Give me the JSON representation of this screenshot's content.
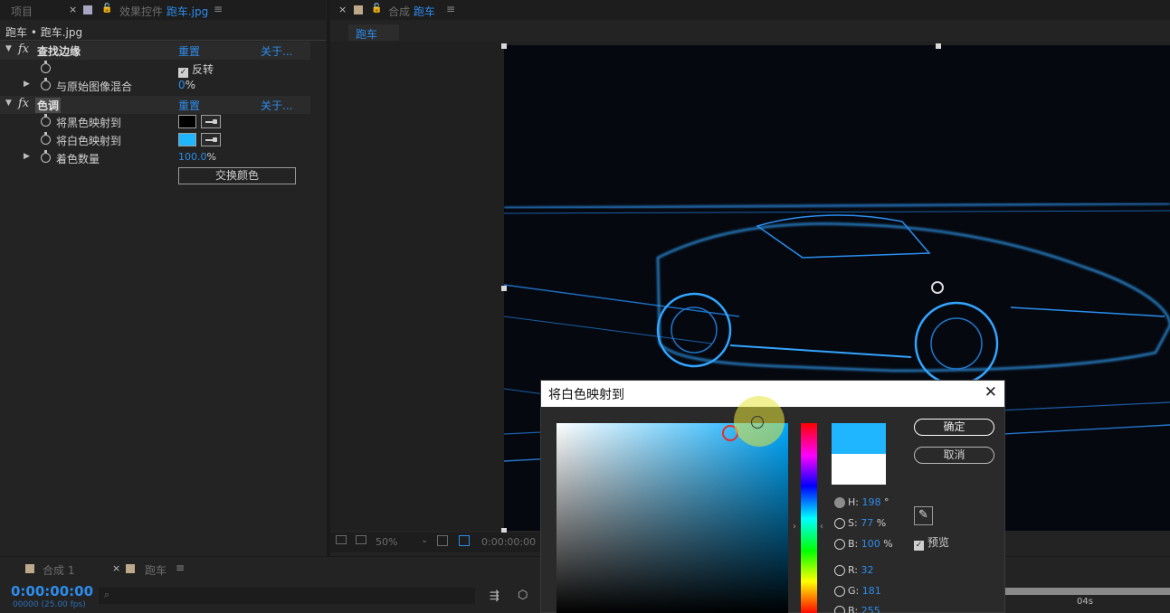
{
  "panels": {
    "project_tab": "项目",
    "effects_tab_prefix": "效果控件",
    "effects_tab_file": "跑车.jpg",
    "comp_tab_prefix": "合成",
    "comp_tab_name": "跑车",
    "comp_subtab": "跑车"
  },
  "effects": {
    "breadcrumb": "跑车 • 跑车.jpg",
    "find_edges": {
      "name": "查找边缘",
      "reset": "重置",
      "about": "关于...",
      "invert_label": "反转",
      "blend_label": "与原始图像混合",
      "blend_value": "0",
      "blend_unit": "%"
    },
    "tint": {
      "name": "色调",
      "reset": "重置",
      "about": "关于...",
      "map_black": "将黑色映射到",
      "map_white": "将白色映射到",
      "amount_label": "着色数量",
      "amount_value": "100.0",
      "amount_unit": "%",
      "swap_button": "交换颜色"
    }
  },
  "viewer": {
    "zoom": "50%",
    "timecode": "0:00:00:00"
  },
  "dialog": {
    "title": "将白色映射到",
    "ok": "确定",
    "cancel": "取消",
    "preview_label": "预览",
    "fields": [
      {
        "label": "H:",
        "value": "198",
        "unit": "°"
      },
      {
        "label": "S:",
        "value": "77",
        "unit": "%"
      },
      {
        "label": "B:",
        "value": "100",
        "unit": "%"
      },
      {
        "label": "R:",
        "value": "32",
        "unit": ""
      },
      {
        "label": "G:",
        "value": "181",
        "unit": ""
      },
      {
        "label": "B:",
        "value": "255",
        "unit": ""
      }
    ]
  },
  "timeline": {
    "tab1": "合成 1",
    "tab2": "跑车",
    "timecode": "0:00:00:00",
    "fps": "00000 (25.00 fps)",
    "ruler_label": "04s"
  },
  "colors": {
    "accent": "#2d8ceb",
    "white_map_color": "#20b5ff",
    "black_map_color": "#000000"
  }
}
